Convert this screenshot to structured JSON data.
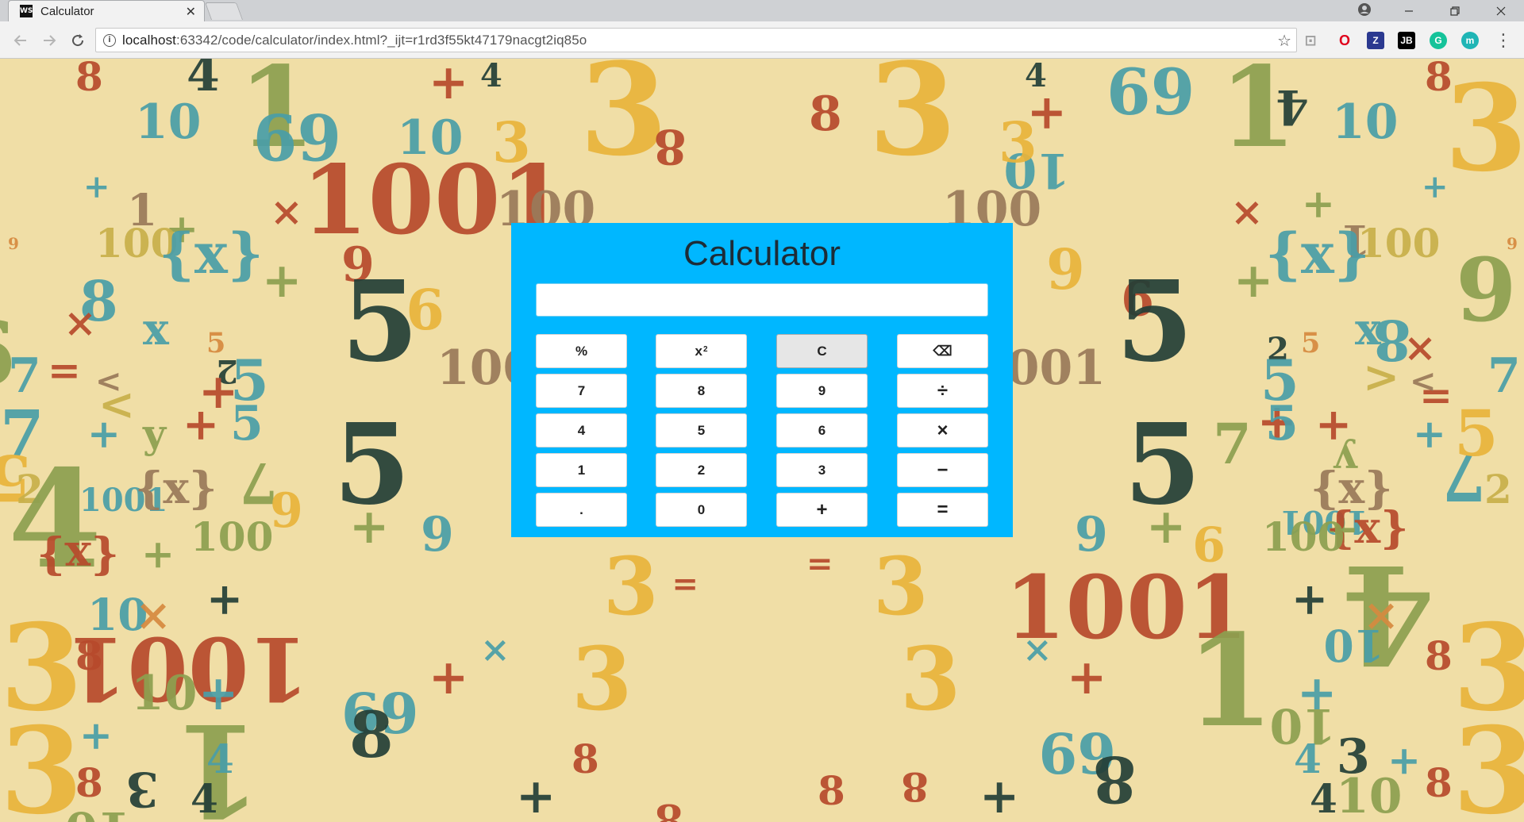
{
  "browser": {
    "tab_title": "Calculator",
    "tab_favicon_text": "WS",
    "url_host": "localhost",
    "url_rest": ":63342/code/calculator/index.html?_ijt=r1rd3f55kt47179nacgt2iq85o",
    "extensions": [
      {
        "name": "pdf-extension-icon",
        "glyph": "⊡",
        "color": "#9e9e9e"
      },
      {
        "name": "opera-extension-icon",
        "glyph": "O",
        "color": "#e0001b"
      },
      {
        "name": "z-extension-icon",
        "glyph": "Z",
        "color": "#2b3990"
      },
      {
        "name": "jetbrains-extension-icon",
        "glyph": "JB",
        "color": "#000000"
      },
      {
        "name": "grammarly-extension-icon",
        "glyph": "G",
        "color": "#15c39a"
      },
      {
        "name": "m-extension-icon",
        "glyph": "m",
        "color": "#1fb5b5"
      }
    ]
  },
  "calculator": {
    "title": "Calculator",
    "display_value": "",
    "keys": [
      {
        "label": "%",
        "name": "percent-button"
      },
      {
        "label": "x",
        "sup": "2",
        "name": "square-button"
      },
      {
        "label": "C",
        "name": "clear-button"
      },
      {
        "label": "⌫",
        "name": "backspace-button"
      },
      {
        "label": "7",
        "name": "digit-7-button"
      },
      {
        "label": "8",
        "name": "digit-8-button"
      },
      {
        "label": "9",
        "name": "digit-9-button"
      },
      {
        "label": "÷",
        "name": "divide-button"
      },
      {
        "label": "4",
        "name": "digit-4-button"
      },
      {
        "label": "5",
        "name": "digit-5-button"
      },
      {
        "label": "6",
        "name": "digit-6-button"
      },
      {
        "label": "×",
        "name": "multiply-button"
      },
      {
        "label": "1",
        "name": "digit-1-button"
      },
      {
        "label": "2",
        "name": "digit-2-button"
      },
      {
        "label": "3",
        "name": "digit-3-button"
      },
      {
        "label": "−",
        "name": "subtract-button"
      },
      {
        "label": ".",
        "name": "decimal-button"
      },
      {
        "label": "0",
        "name": "digit-0-button"
      },
      {
        "label": "+",
        "name": "add-button"
      },
      {
        "label": "=",
        "name": "equals-button"
      }
    ],
    "colors": {
      "panel": "#00b7ff",
      "title": "#1d2c37",
      "key": "#ffffff",
      "clear_key": "#e6e6e6"
    }
  },
  "background": {
    "base_color": "#f0dea6",
    "palette": [
      "#e9b43b",
      "#b74a2c",
      "#243f37",
      "#4a9ea8",
      "#8da050",
      "#c8b04a",
      "#9a7a5a",
      "#d68a40"
    ],
    "glyphs": [
      "3",
      "8",
      "10",
      "4",
      "1",
      "69",
      "+",
      "×",
      "100",
      "1001",
      "9",
      "{x}",
      "x",
      "5",
      "2",
      "7",
      "=",
      "<",
      ">",
      "y"
    ]
  }
}
